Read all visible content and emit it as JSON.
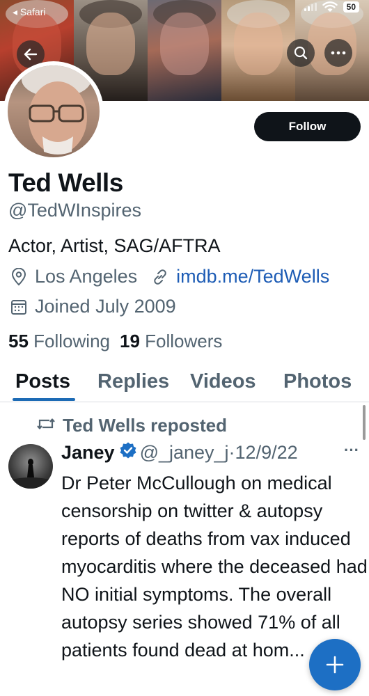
{
  "status_bar": {
    "back_app": "◂ Safari",
    "battery": "50"
  },
  "profile": {
    "name": "Ted Wells",
    "handle": "@TedWInspires",
    "bio": "Actor, Artist, SAG/AFTRA",
    "location": "Los Angeles",
    "link": "imdb.me/TedWells",
    "joined": "Joined July 2009",
    "following_count": "55",
    "following_label": "Following",
    "followers_count": "19",
    "followers_label": "Followers",
    "follow_button": "Follow"
  },
  "tabs": [
    {
      "label": "Posts",
      "active": true
    },
    {
      "label": "Replies",
      "active": false
    },
    {
      "label": "Videos",
      "active": false
    },
    {
      "label": "Photos",
      "active": false
    }
  ],
  "feed": {
    "repost_label": "Ted Wells reposted",
    "tweet": {
      "author_name": "Janey",
      "author_meta": "@_janey_j·12/9/22",
      "more": "···",
      "text": "Dr Peter McCullough on medical censorship on twitter & autopsy reports of deaths from vax induced myocarditis where the deceased had NO initial symptoms. The overall autopsy series showed 71% of all patients found dead at hom..."
    }
  },
  "icons": {
    "back": "arrow-left-icon",
    "search": "search-icon",
    "more": "more-horizontal-icon",
    "location": "location-pin-icon",
    "link": "link-icon",
    "calendar": "calendar-icon",
    "repost": "repost-icon",
    "verified": "verified-badge-icon",
    "compose": "plus-icon"
  },
  "colors": {
    "accent": "#1d6fc4",
    "text_primary": "#0f1419",
    "text_secondary": "#536471",
    "follow_button_bg": "#0f1419"
  }
}
